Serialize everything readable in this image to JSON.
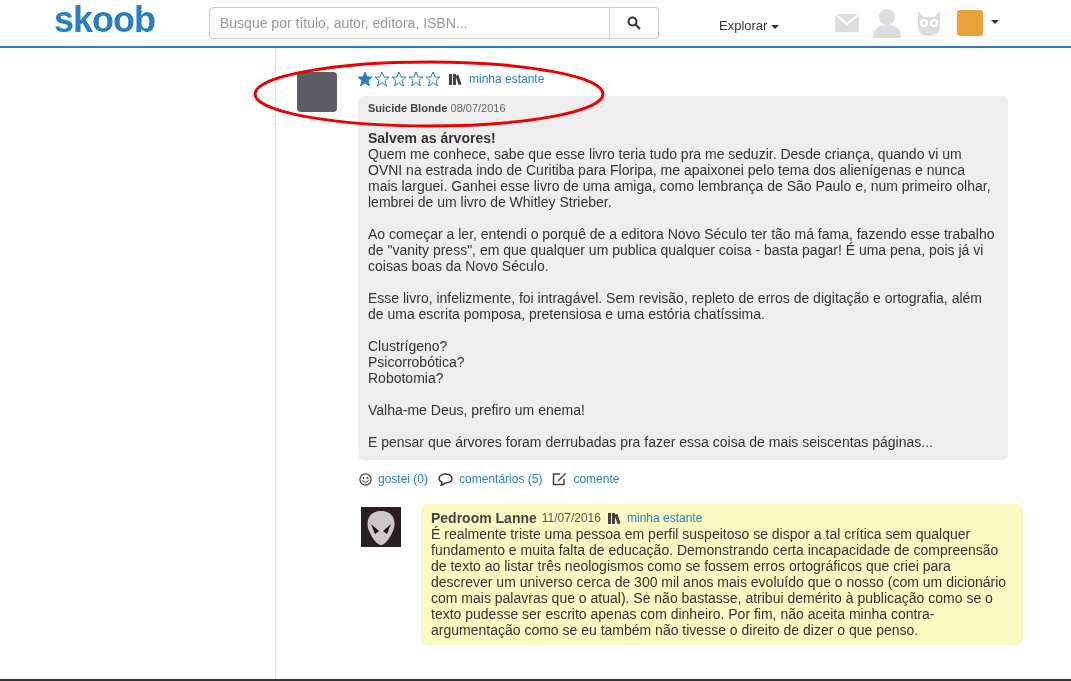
{
  "header": {
    "logo": "skoob",
    "search": {
      "placeholder": "Busque por título, autor, editora, ISBN..."
    },
    "explore": "Explorar"
  },
  "review": {
    "stars": 1,
    "shelf_link": "minha estante",
    "author": "Suicide Blonde",
    "date": "08/07/2016",
    "title": "Salvem as árvores!",
    "paragraphs": [
      [
        "Quem me conhece, sabe que esse livro teria tudo pra me seduzir. Desde criança, quando vi um OVNI na estrada indo de Curitiba para Floripa, me apaixonei pelo tema dos alienígenas e nunca mais larguei. Ganhei esse livro de uma amiga, como lembrança de São Paulo e, num primeiro olhar, lembrei de um livro de Whitley Strieber."
      ],
      [
        "Ao começar a ler, entendi o porquê de a editora Novo Século ter tão má fama, fazendo esse trabalho de \"vanity press\", em que qualquer um publica qualquer coisa - basta pagar! É uma pena, pois já vi coisas boas da Novo Século."
      ],
      [
        "Esse livro, infelizmente, foi intragável. Sem revisão, repleto de erros de digitação e ortografia, além de uma escrita pomposa, pretensiosa e uma estória chatíssima."
      ],
      [
        "Clustrígeno?",
        "Psicorrobótica?",
        "Robotomia?"
      ],
      [
        "Valha-me Deus, prefiro um enema!"
      ],
      [
        "E pensar que árvores foram derrubadas pra fazer essa coisa de mais seiscentas páginas..."
      ]
    ],
    "actions": {
      "likes": "gostei (0)",
      "comments": "comentários (5)",
      "comment": "comente"
    }
  },
  "comment": {
    "author": "Pedroom Lanne",
    "date": "11/07/2016",
    "shelf_link": "minha estante",
    "text": "É realmente triste uma pessoa em perfil suspeitoso se dispor a tal crítica sem qualquer fundamento e muita falta de educação. Demonstrando certa incapacidade de compreensão de texto ao listar três neologismos como se fossem erros ortográficos que criei para descrever um universo cerca de 300 mil anos mais evoluído que o nosso (com um dicionário com mais palavras que o atual). Se não bastasse, atribui demérito à publicação como se o texto pudesse ser escrito apenas com dinheiro. Por fim, não aceita minha contra-argumentação como se eu também não tivesse o direito de dizer o que penso."
  }
}
